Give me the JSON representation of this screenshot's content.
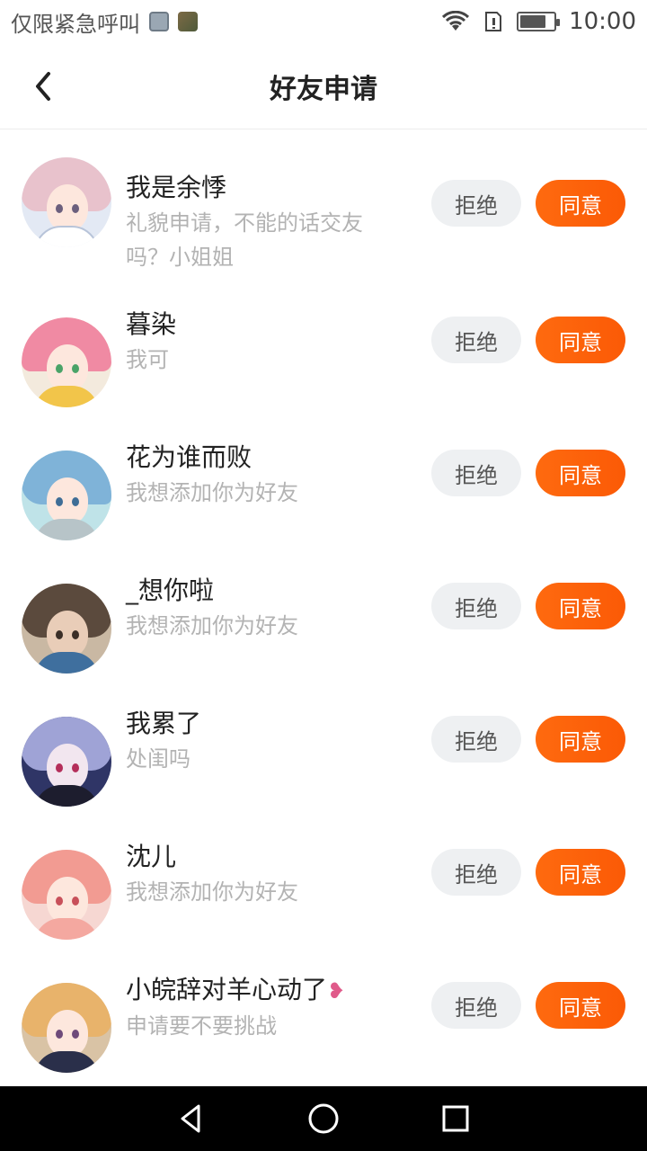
{
  "status_bar": {
    "carrier": "仅限紧急呼叫",
    "time": "10:00",
    "battery_level": 0.7
  },
  "header": {
    "title": "好友申请",
    "back_icon": "chevron-left-icon"
  },
  "requests": [
    {
      "name": "我是余悸",
      "message": "礼貌申请，不能的话交友吗？小姐姐",
      "reject_label": "拒绝",
      "accept_label": "同意"
    },
    {
      "name": "暮染",
      "message": "我可",
      "reject_label": "拒绝",
      "accept_label": "同意"
    },
    {
      "name": "花为谁而败",
      "message": "我想添加你为好友",
      "reject_label": "拒绝",
      "accept_label": "同意"
    },
    {
      "name": "_想你啦",
      "message": "我想添加你为好友",
      "reject_label": "拒绝",
      "accept_label": "同意"
    },
    {
      "name": "我累了",
      "message": "处闺吗",
      "reject_label": "拒绝",
      "accept_label": "同意"
    },
    {
      "name": "沈儿",
      "message": "我想添加你为好友",
      "reject_label": "拒绝",
      "accept_label": "同意"
    },
    {
      "name": "小皖辞对羊心动了",
      "message": "申请要不要挑战",
      "reject_label": "拒绝",
      "accept_label": "同意"
    }
  ],
  "colors": {
    "accept": "#fb5a06",
    "reject_bg": "#eef0f2",
    "message_text": "#b3b3b3"
  }
}
